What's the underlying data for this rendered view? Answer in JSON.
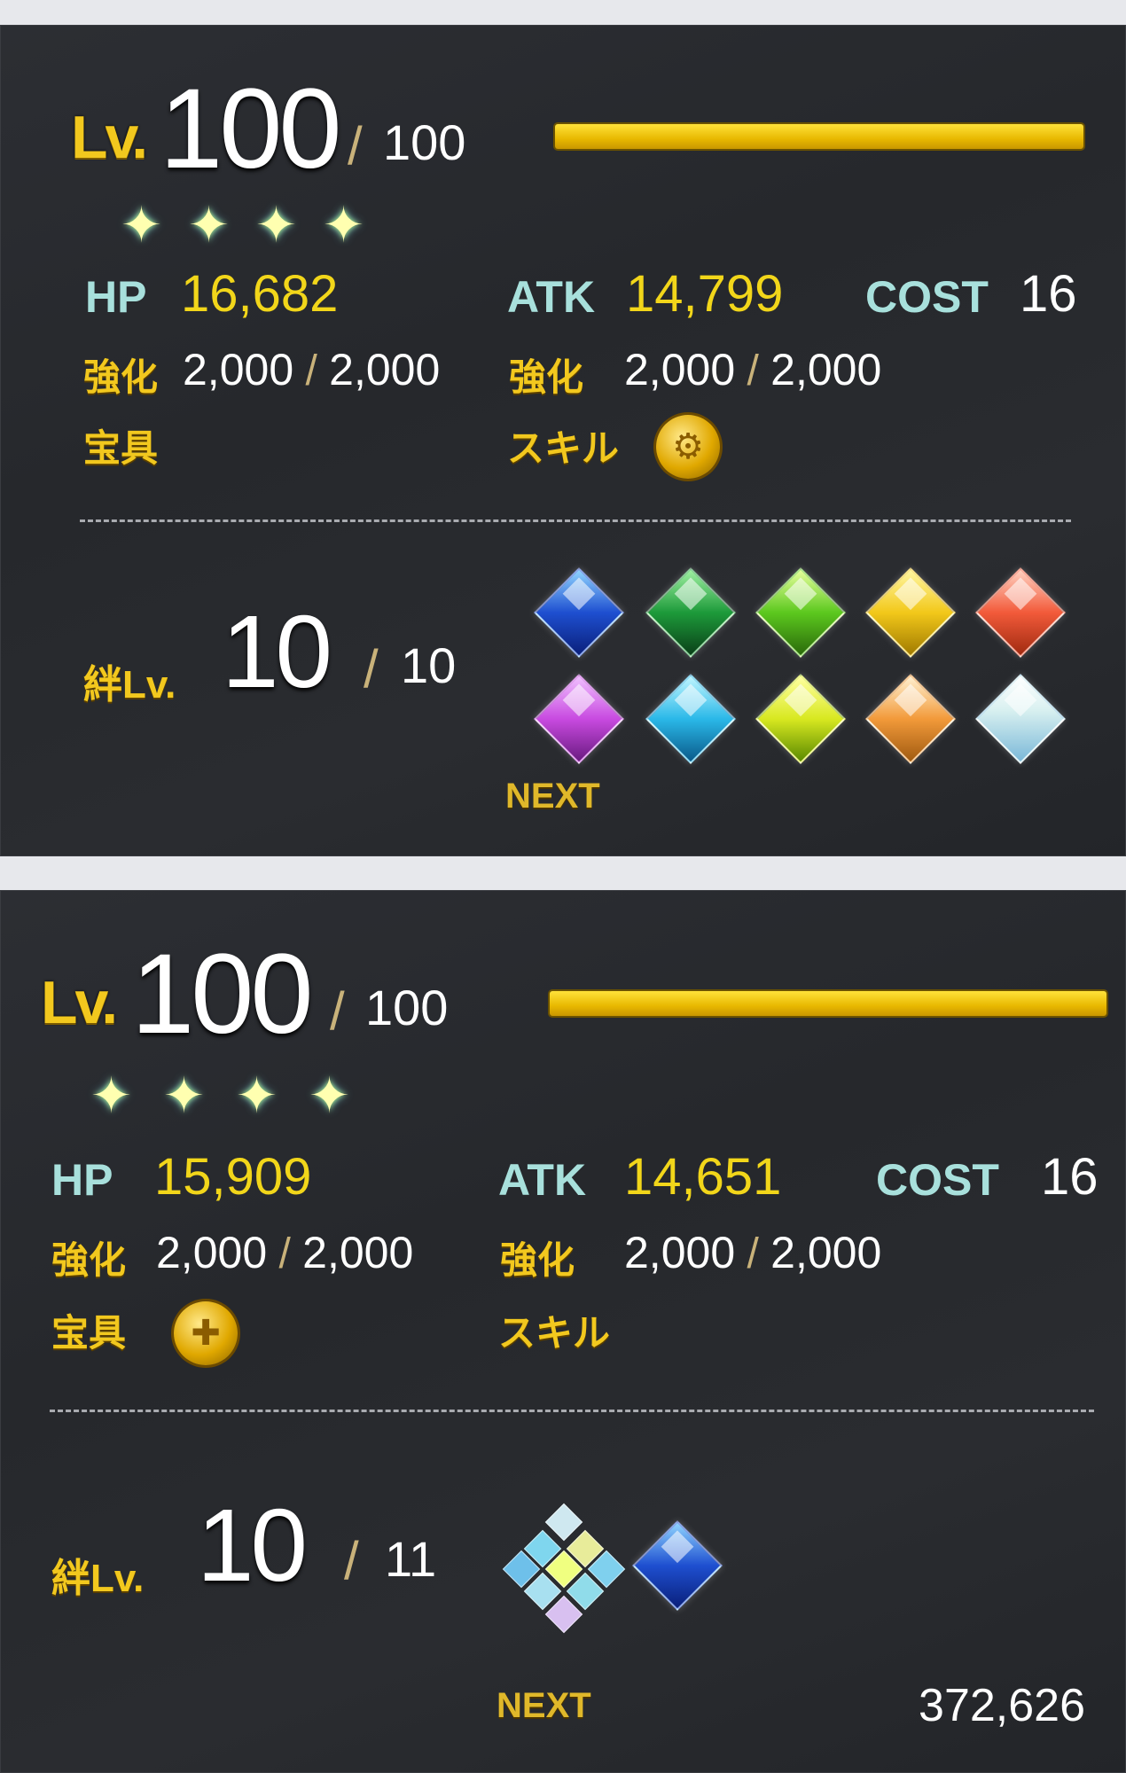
{
  "cards": [
    {
      "level_label": "Lv.",
      "level": "100",
      "slash": "/",
      "level_max": "100",
      "level_fill": 1.0,
      "stars": [
        "✦",
        "✦",
        "✦",
        "✦"
      ],
      "hp_label": "HP",
      "hp": "16,682",
      "atk_label": "ATK",
      "atk": "14,799",
      "cost_label": "COST",
      "cost": "16",
      "hp_fou_label": "強化",
      "hp_fou": "2,000",
      "hp_fou_max": "2,000",
      "atk_fou_label": "強化",
      "atk_fou": "2,000",
      "atk_fou_max": "2,000",
      "np_label": "宝具",
      "skill_label": "スキル",
      "bond_label": "絆Lv.",
      "bond": "10",
      "bond_max": "10",
      "next_label": "NEXT",
      "next_value": ""
    },
    {
      "level_label": "Lv.",
      "level": "100",
      "slash": "/",
      "level_max": "100",
      "level_fill": 1.0,
      "stars": [
        "✦",
        "✦",
        "✦",
        "✦"
      ],
      "hp_label": "HP",
      "hp": "15,909",
      "atk_label": "ATK",
      "atk": "14,651",
      "cost_label": "COST",
      "cost": "16",
      "hp_fou_label": "強化",
      "hp_fou": "2,000",
      "hp_fou_max": "2,000",
      "atk_fou_label": "強化",
      "atk_fou": "2,000",
      "atk_fou_max": "2,000",
      "np_label": "宝具",
      "skill_label": "スキル",
      "bond_label": "絆Lv.",
      "bond": "10",
      "bond_max": "11",
      "next_label": "NEXT",
      "next_value": "372,626"
    }
  ],
  "bond_gem_colors": [
    "#1e4fd0",
    "#1d9a3a",
    "#5cc81e",
    "#f2c81a",
    "#f25a3a",
    "#c84ae0",
    "#2ab8e8",
    "#d8e820",
    "#f29a3a",
    "#d8f0f0"
  ],
  "icons": {
    "star": "four-point-star-icon",
    "skill_medal": "skill-medal-icon",
    "np_medal": "np-medal-icon",
    "bond_gem": "bond-gem-icon"
  }
}
